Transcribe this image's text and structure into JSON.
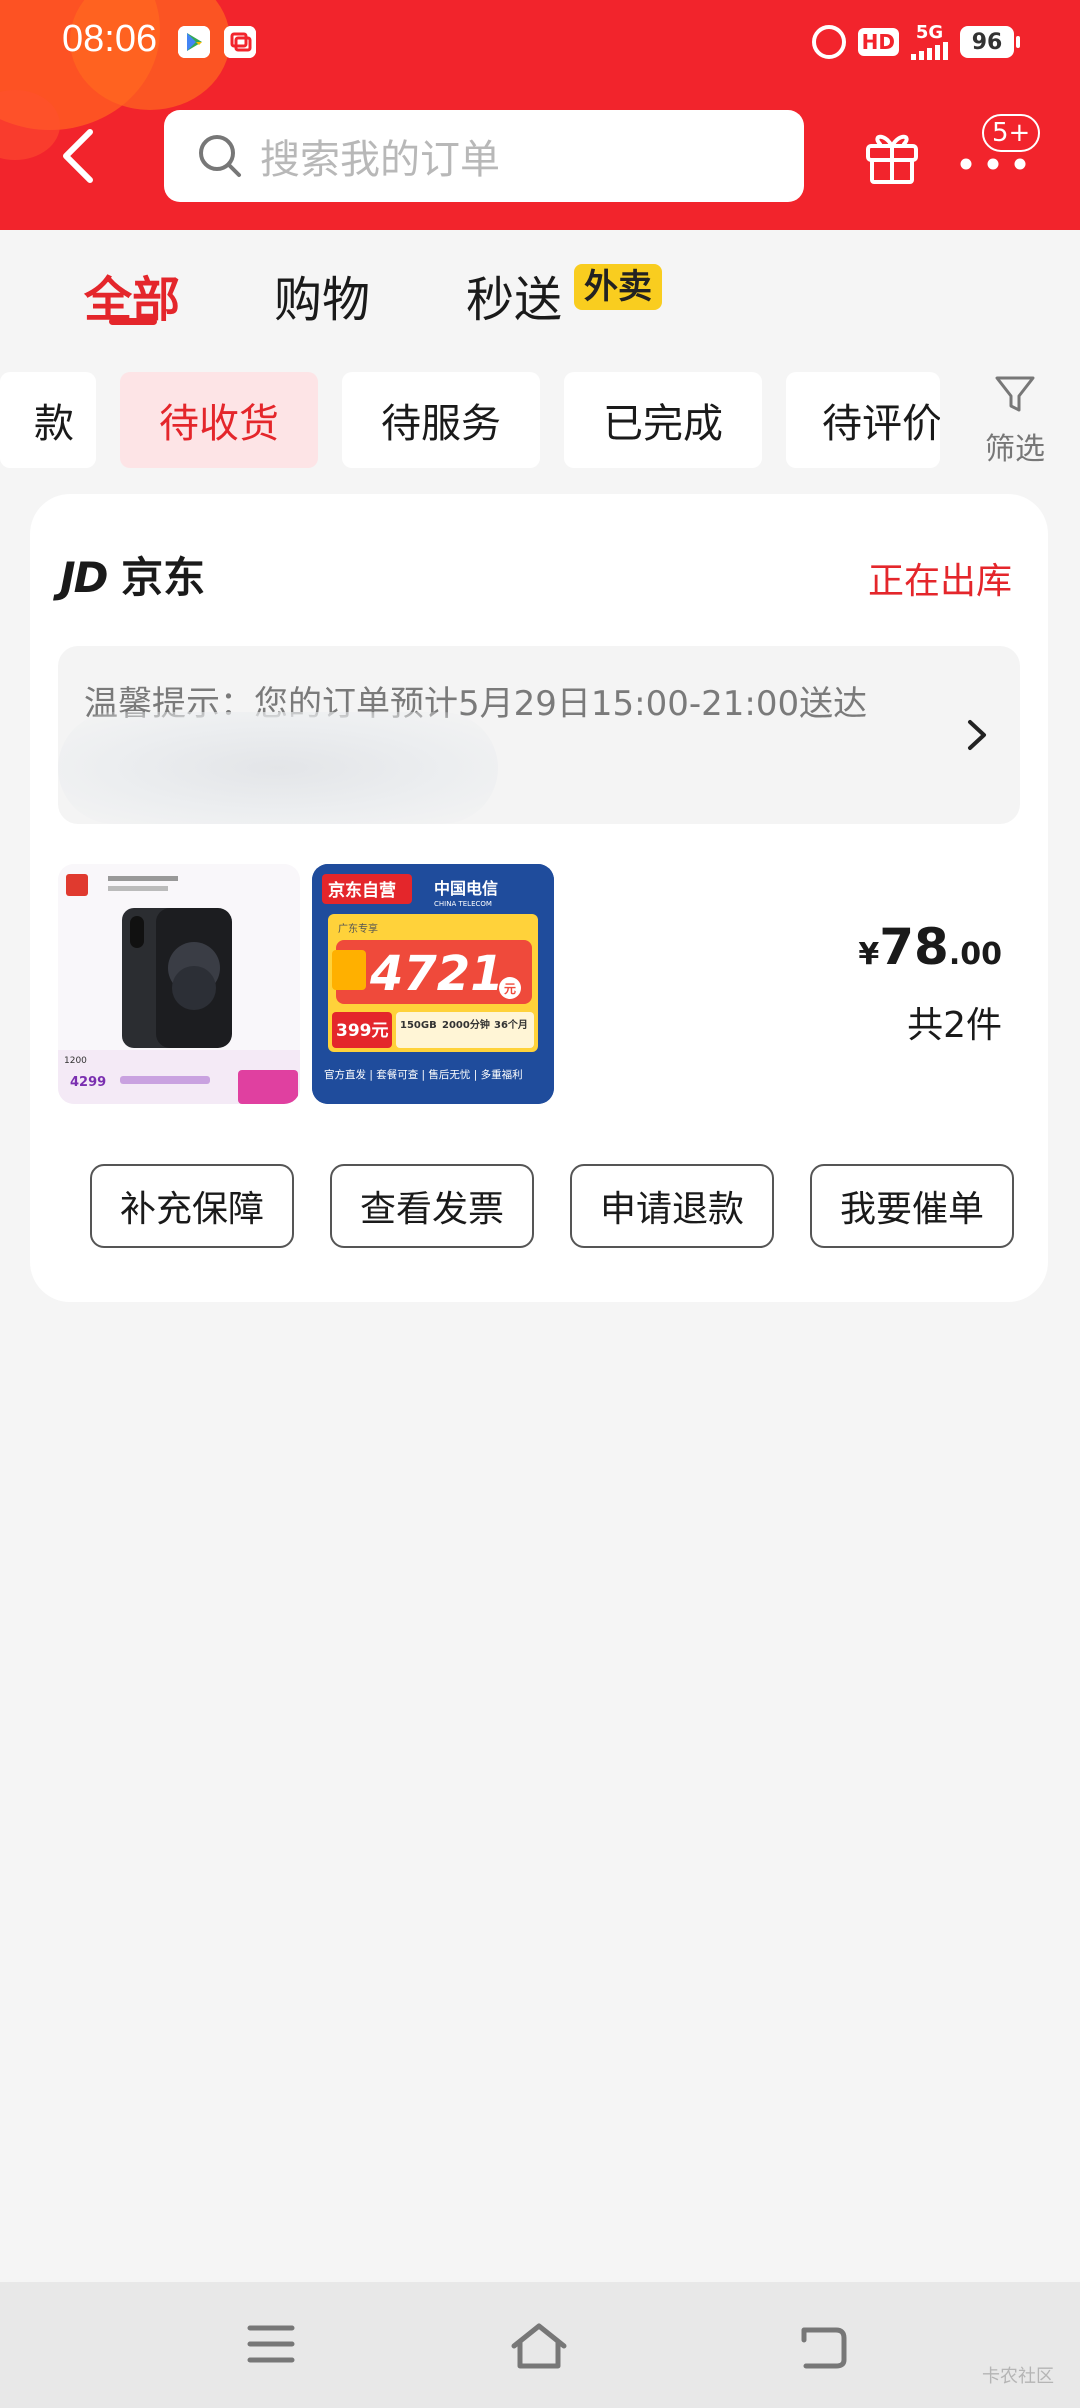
{
  "status_bar": {
    "time": "08:06",
    "hd": "HD",
    "network": "5G",
    "battery": "96"
  },
  "header": {
    "search_placeholder": "搜索我的订单",
    "message_badge": "5+"
  },
  "tabs": [
    {
      "label": "全部",
      "active": true
    },
    {
      "label": "购物",
      "active": false
    },
    {
      "label": "秒送",
      "active": false,
      "tag": "外卖"
    }
  ],
  "filter_chips": [
    {
      "label": "款",
      "active": false
    },
    {
      "label": "待收货",
      "active": true
    },
    {
      "label": "待服务",
      "active": false
    },
    {
      "label": "已完成",
      "active": false
    },
    {
      "label": "待评价",
      "active": false
    }
  ],
  "filter_label": "筛选",
  "order": {
    "store_logo": "JD",
    "store_name": "京东",
    "status": "正在出库",
    "tip": "温馨提示：您的订单预计5月29日15:00-21:00送达",
    "price_currency": "¥",
    "price_int": "78",
    "price_dec": ".00",
    "item_count": "共2件",
    "items": [
      {
        "name": "phone-product-image",
        "note": "1200",
        "price_tag": "4299"
      },
      {
        "name": "telecom-card-image",
        "header": "京东自营",
        "brand": "中国电信",
        "brand_en": "CHINA TELECOM",
        "region": "广东专享",
        "amount": "4721",
        "unit": "元",
        "monthly": "399元",
        "data_1": "150GB",
        "data_2": "2000分钟",
        "data_3": "36个月",
        "footer": "官方直发 | 套餐可查 | 售后无忧 | 多重福利"
      }
    ],
    "actions": [
      "补充保障",
      "查看发票",
      "申请退款",
      "我要催单"
    ]
  },
  "watermark": "卡农社区",
  "colors": {
    "brand_red": "#f2242c",
    "accent_red": "#e4262b",
    "chip_active_bg": "#fde4e6",
    "waimai_yellow": "#f9cd1f"
  }
}
